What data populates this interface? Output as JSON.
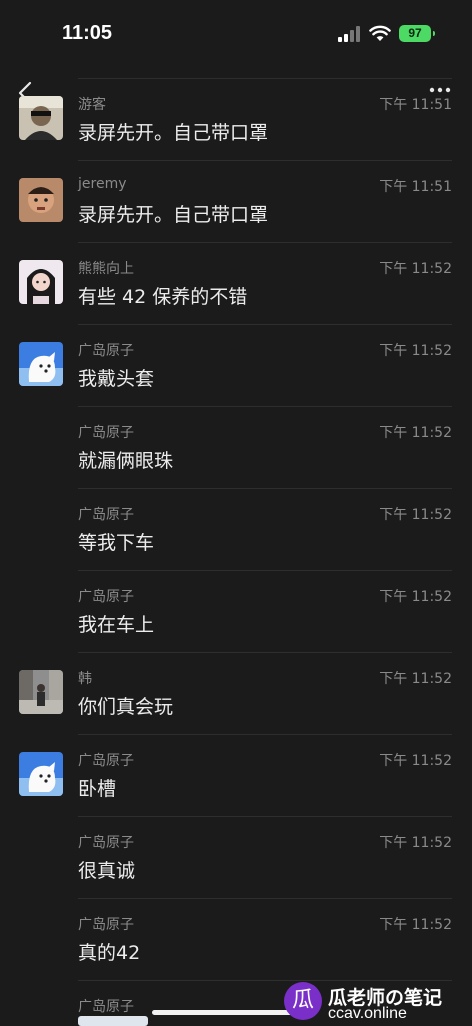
{
  "status_bar": {
    "time": "11:05",
    "battery": "97"
  },
  "nav": {
    "back_icon": "chevron-left-icon",
    "more_icon": "ellipsis-icon"
  },
  "messages": [
    {
      "sender": "游客",
      "time": "下午 11:51",
      "text": "录屏先开。自己带口罩",
      "avatar": "avatar-1"
    },
    {
      "sender": "jeremy",
      "time": "下午 11:51",
      "text": "录屏先开。自己带口罩",
      "avatar": "avatar-2"
    },
    {
      "sender": "熊熊向上",
      "time": "下午 11:52",
      "text": "有些 42 保养的不错",
      "avatar": "avatar-3"
    },
    {
      "sender": "广岛原子",
      "time": "下午 11:52",
      "text": "我戴头套",
      "avatar": "avatar-dog"
    },
    {
      "sender": "广岛原子",
      "time": "下午 11:52",
      "text": "就漏俩眼珠",
      "avatar": ""
    },
    {
      "sender": "广岛原子",
      "time": "下午 11:52",
      "text": "等我下车",
      "avatar": ""
    },
    {
      "sender": "广岛原子",
      "time": "下午 11:52",
      "text": "我在车上",
      "avatar": ""
    },
    {
      "sender": "韩",
      "time": "下午 11:52",
      "text": "你们真会玩",
      "avatar": "avatar-4"
    },
    {
      "sender": "广岛原子",
      "time": "下午 11:52",
      "text": "卧槽",
      "avatar": "avatar-dog"
    },
    {
      "sender": "广岛原子",
      "time": "下午 11:52",
      "text": "很真诚",
      "avatar": ""
    },
    {
      "sender": "广岛原子",
      "time": "下午 11:52",
      "text": "真的42",
      "avatar": ""
    },
    {
      "sender": "广岛原子",
      "time": "",
      "text": "",
      "avatar": ""
    }
  ],
  "watermark": {
    "logo_glyph": "瓜",
    "title": "瓜老师の笔记",
    "url": "ccav.online"
  }
}
